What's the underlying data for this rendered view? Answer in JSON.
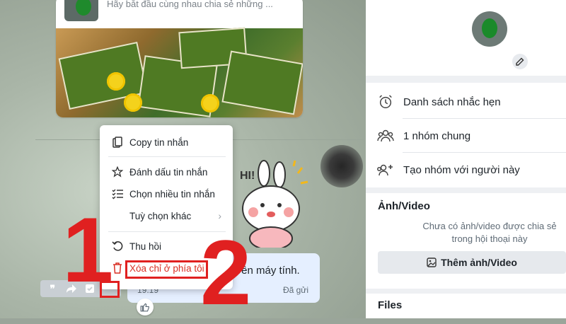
{
  "chat": {
    "pinned_preview": "Hãy bắt đầu cùng nhau chia sẻ những ...",
    "sent_message": {
      "text": "trên máy tính.",
      "time": "19:19",
      "status": "Đã gửi"
    },
    "toolbar": {
      "icons": [
        "quote-icon",
        "forward-icon",
        "task-icon",
        "more-icon"
      ],
      "quote_glyph": "❞",
      "more_glyph": "•••"
    }
  },
  "context_menu": {
    "copy": "Copy tin nhắn",
    "star": "Đánh dấu tin nhắn",
    "select_multi": "Chọn nhiều tin nhắn",
    "more_options": "Tuỳ chọn khác",
    "recall": "Thu hồi",
    "delete_mine": "Xóa chỉ ở phía tôi"
  },
  "annotations": {
    "step1": "1",
    "step2": "2",
    "highlight_color": "#e02020"
  },
  "right_panel": {
    "reminders": "Danh sách nhắc hẹn",
    "common_groups": "1 nhóm chung",
    "create_group": "Tạo nhóm với người này",
    "media_title": "Ảnh/Video",
    "media_empty": "Chưa có ảnh/video được chia sẻ trong hội thoại này",
    "add_media": "Thêm ảnh/Video",
    "files_title": "Files"
  },
  "colors": {
    "danger": "#d93025",
    "accent_bubble": "#e5efff"
  }
}
